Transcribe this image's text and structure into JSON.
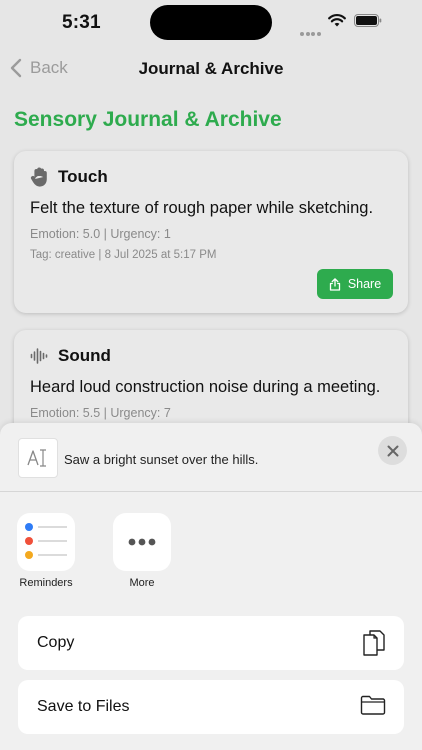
{
  "status_bar": {
    "time": "5:31"
  },
  "nav": {
    "back_label": "Back",
    "title": "Journal & Archive"
  },
  "page": {
    "heading": "Sensory Journal & Archive"
  },
  "entries": [
    {
      "category": "Touch",
      "icon": "hand-icon",
      "text": "Felt the texture of rough paper while sketching.",
      "metrics": "Emotion: 5.0 | Urgency: 1",
      "tag_line": "Tag: creative | 8 Jul 2025 at 5:17 PM",
      "share_label": "Share"
    },
    {
      "category": "Sound",
      "icon": "waveform-icon",
      "text": "Heard loud construction noise during a meeting.",
      "metrics": "Emotion: 5.5 | Urgency: 7"
    }
  ],
  "share_sheet": {
    "preview_text": "Saw a bright sunset over the hills.",
    "apps": [
      {
        "label": "Reminders",
        "icon": "reminders-icon"
      },
      {
        "label": "More",
        "icon": "more-icon"
      }
    ],
    "actions": [
      {
        "label": "Copy",
        "icon": "copy-icon"
      },
      {
        "label": "Save to Files",
        "icon": "folder-icon"
      }
    ]
  },
  "colors": {
    "accent": "#2eab4e",
    "background": "#e6e6e6",
    "sheet": "#f0f0f0"
  }
}
